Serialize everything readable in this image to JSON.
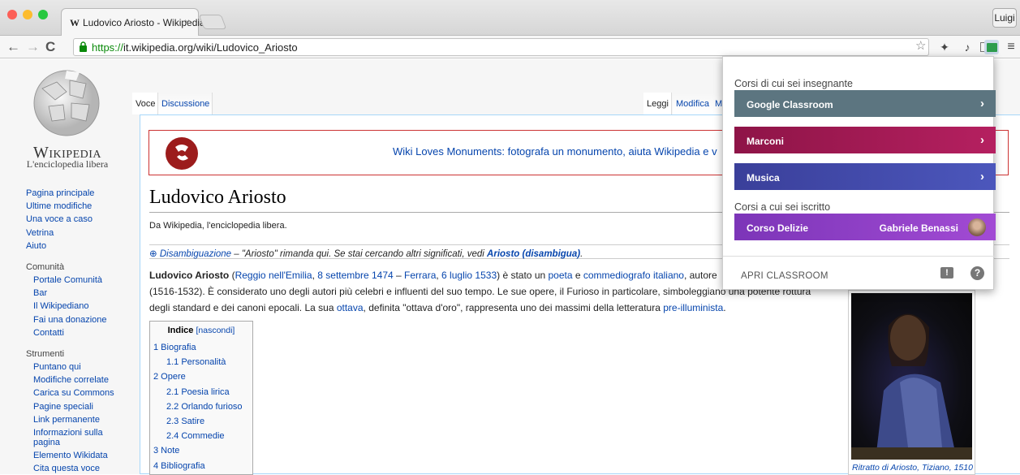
{
  "browser": {
    "tab_title": "Ludovico Ariosto - Wikipedia",
    "tab_logo": "W",
    "tab_close": "×",
    "profile": "Luigi",
    "url_scheme": "https://",
    "url_rest": "it.wikipedia.org/wiki/Ludovico_Ariosto",
    "icons": [
      "back-icon",
      "forward-icon",
      "reload-icon",
      "lock-icon",
      "star-icon",
      "extension-icon",
      "cast-icon",
      "classroom-icon",
      "menu-icon"
    ]
  },
  "wiki": {
    "title": "Wikipedia",
    "subtitle": "L'enciclopedia libera",
    "nav_links": [
      "Pagina principale",
      "Ultime modifiche",
      "Una voce a caso",
      "Vetrina",
      "Aiuto"
    ],
    "community_heading": "Comunità",
    "community_links": [
      "Portale Comunità",
      "Bar",
      "Il Wikipediano",
      "Fai una donazione",
      "Contatti"
    ],
    "tools_heading": "Strumenti",
    "tools_links": [
      "Puntano qui",
      "Modifiche correlate",
      "Carica su Commons",
      "Pagine speciali",
      "Link permanente",
      "Informazioni sulla pagina",
      "Elemento Wikidata",
      "Cita questa voce"
    ],
    "tab_voce": "Voce",
    "tab_discussione": "Discussione",
    "tab_leggi": "Leggi",
    "tab_modifica": "Modifica",
    "tab_partial": "M",
    "banner_text": "Wiki Loves Monuments: fotografa un monumento, aiuta Wikipedia e v",
    "article_title": "Ludovico Ariosto",
    "from_wiki": "Da Wikipedia, l'enciclopedia libera.",
    "disamb_prefix": "Disambiguazione",
    "disamb_middle": " – \"Ariosto\" rimanda qui. Se stai cercando altri significati, vedi ",
    "disamb_link": "Ariosto (disambigua)",
    "disamb_end": ".",
    "lead": {
      "name": "Ludovico Ariosto",
      "open_paren": " (",
      "birthplace": "Reggio nell'Emilia",
      "comma1": ", ",
      "birthdate": "8 settembre",
      "space1": " ",
      "birthyear": "1474",
      "dash": " – ",
      "deathplace": "Ferrara",
      "comma2": ", ",
      "deathdate": "6 luglio",
      "space2": " ",
      "deathyear": "1533",
      "close": ") è stato un ",
      "poeta": "poeta",
      "e": " e ",
      "commediografo": "commediografo",
      "space3": " ",
      "italiano": "italiano",
      "autore": ", autore",
      "line2": "(1516-1532). È considerato uno degli autori più celebri e influenti del suo tempo. Le sue opere, il Furioso in particolare, simboleggiano una potente rottura",
      "line3a": "degli standard e dei canoni epocali. La sua ",
      "ottava": "ottava",
      "line3b": ", definita \"ottava d'oro\", rappresenta uno dei massimi della letteratura ",
      "preilluminista": "pre-illuminista",
      "line3c": "."
    },
    "toc_heading": "Indice",
    "toc_toggle": "[nascondi]",
    "toc": [
      "1 Biografia",
      "1.1 Personalità",
      "2 Opere",
      "2.1 Poesia lirica",
      "2.2 Orlando furioso",
      "2.3 Satire",
      "2.4 Commedie",
      "3 Note",
      "4 Bibliografia"
    ],
    "portrait_caption": "Ritratto di Ariosto, Tiziano, 1510"
  },
  "classroom": {
    "teacher_label": "Corsi di cui sei insegnante",
    "student_label": "Corsi a cui sei iscritto",
    "courses": [
      {
        "name": "Google Classroom",
        "color": "#5c7580"
      },
      {
        "name": "Marconi",
        "color": "#a11a52"
      },
      {
        "name": "Musica",
        "color": "#3f4aa8"
      }
    ],
    "enrolled": {
      "name": "Corso Delizie",
      "teacher": "Gabriele Benassi",
      "color": "#8e3cc4"
    },
    "open_label": "APRI CLASSROOM",
    "chevron": "›",
    "feedback_glyph": "!",
    "help_glyph": "?"
  }
}
